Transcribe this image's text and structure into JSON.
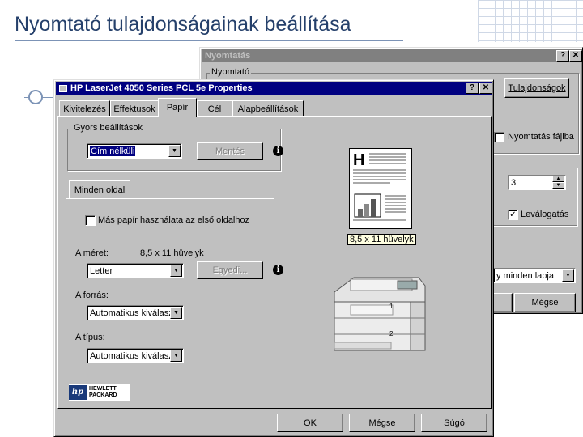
{
  "slide": {
    "title": "Nyomtató tulajdonságainak beállítása"
  },
  "print_dialog": {
    "title": "Nyomtatás",
    "group_label": "Nyomtató",
    "properties_button": "Tulajdonságok",
    "print_to_file_label": "Nyomtatás fájlba",
    "print_to_file_checked": false,
    "copies_value": "3",
    "collate_label": "Leválogatás",
    "collate_checked": true,
    "pages_select_value": "y minden lapja",
    "ok_label": "",
    "cancel_label": "Mégse",
    "help_icon": "?",
    "close_icon": "✕"
  },
  "props_dialog": {
    "title": "HP LaserJet 4050 Series PCL 5e Properties",
    "help_icon": "?",
    "close_icon": "✕",
    "tabs": [
      "Kivitelezés",
      "Effektusok",
      "Papír",
      "Cél",
      "Alapbeállítások"
    ],
    "active_tab": "Papír",
    "quick_sets": {
      "label": "Gyors beállítások",
      "value": "Cím nélküli",
      "save_button": "Mentés"
    },
    "inner_tab": "Minden oldal",
    "different_paper_label": "Más papír használata az első oldalhoz",
    "different_paper_checked": false,
    "size": {
      "label": "A méret:",
      "value_text": "8,5 x 11 hüvelyk",
      "select_value": "Letter",
      "custom_button": "Egyedi..."
    },
    "source": {
      "label": "A forrás:",
      "select_value": "Automatikus kiválasz"
    },
    "type": {
      "label": "A típus:",
      "select_value": "Automatikus kiválasz"
    },
    "preview_size_label": "8,5 x 11 hüvelyk",
    "preview_letter": "H",
    "tray_labels": [
      "1",
      "2"
    ],
    "logo": {
      "line1": "HEWLETT",
      "line2": "PACKARD",
      "mark": "hp"
    },
    "buttons": {
      "ok": "OK",
      "cancel": "Mégse",
      "help": "Súgó"
    }
  },
  "colors": {
    "titlebar_active": "#000080",
    "titlebar_inactive": "#808080",
    "dialog_face": "#c0c0c0",
    "slide_title": "#25406b"
  }
}
